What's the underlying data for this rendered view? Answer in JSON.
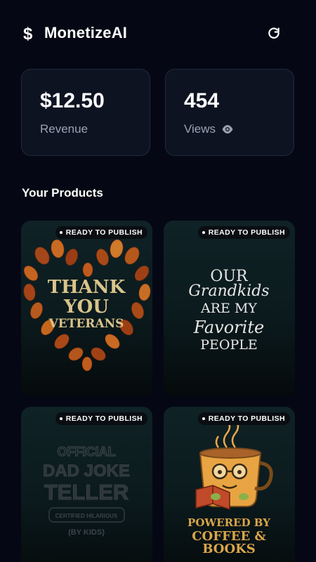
{
  "app": {
    "title": "MonetizeAI",
    "logo_icon": "dollar-sign-icon",
    "refresh_icon": "refresh-icon"
  },
  "stats": {
    "revenue": {
      "value": "$12.50",
      "label": "Revenue"
    },
    "views": {
      "value": "454",
      "label": "Views",
      "icon": "eye-icon"
    }
  },
  "products_section": {
    "title": "Your Products",
    "items": [
      {
        "status": "READY TO PUBLISH",
        "art_lines": [
          "THANK",
          "YOU",
          "VETERANS"
        ],
        "art_icon": "autumn-leaf-heart"
      },
      {
        "status": "READY TO PUBLISH",
        "art_lines": [
          "OUR",
          "Grandkids",
          "ARE MY",
          "Favorite",
          "PEOPLE"
        ]
      },
      {
        "status": "READY TO PUBLISH",
        "art_lines": [
          "OFFICIAL",
          "DAD JOKE",
          "TELLER",
          "CERTIFIED HILARIOUS",
          "(BY KIDS)"
        ]
      },
      {
        "status": "READY TO PUBLISH",
        "art_lines": [
          "POWERED BY",
          "COFFEE &",
          "BOOKS"
        ],
        "art_icon": "coffee-cup-reading-icon"
      }
    ]
  },
  "colors": {
    "background": "#050814",
    "card": "#0e1322",
    "muted_text": "#9aa3b2",
    "accent_gold": "#d9c48a",
    "accent_orange": "#c0661e"
  }
}
